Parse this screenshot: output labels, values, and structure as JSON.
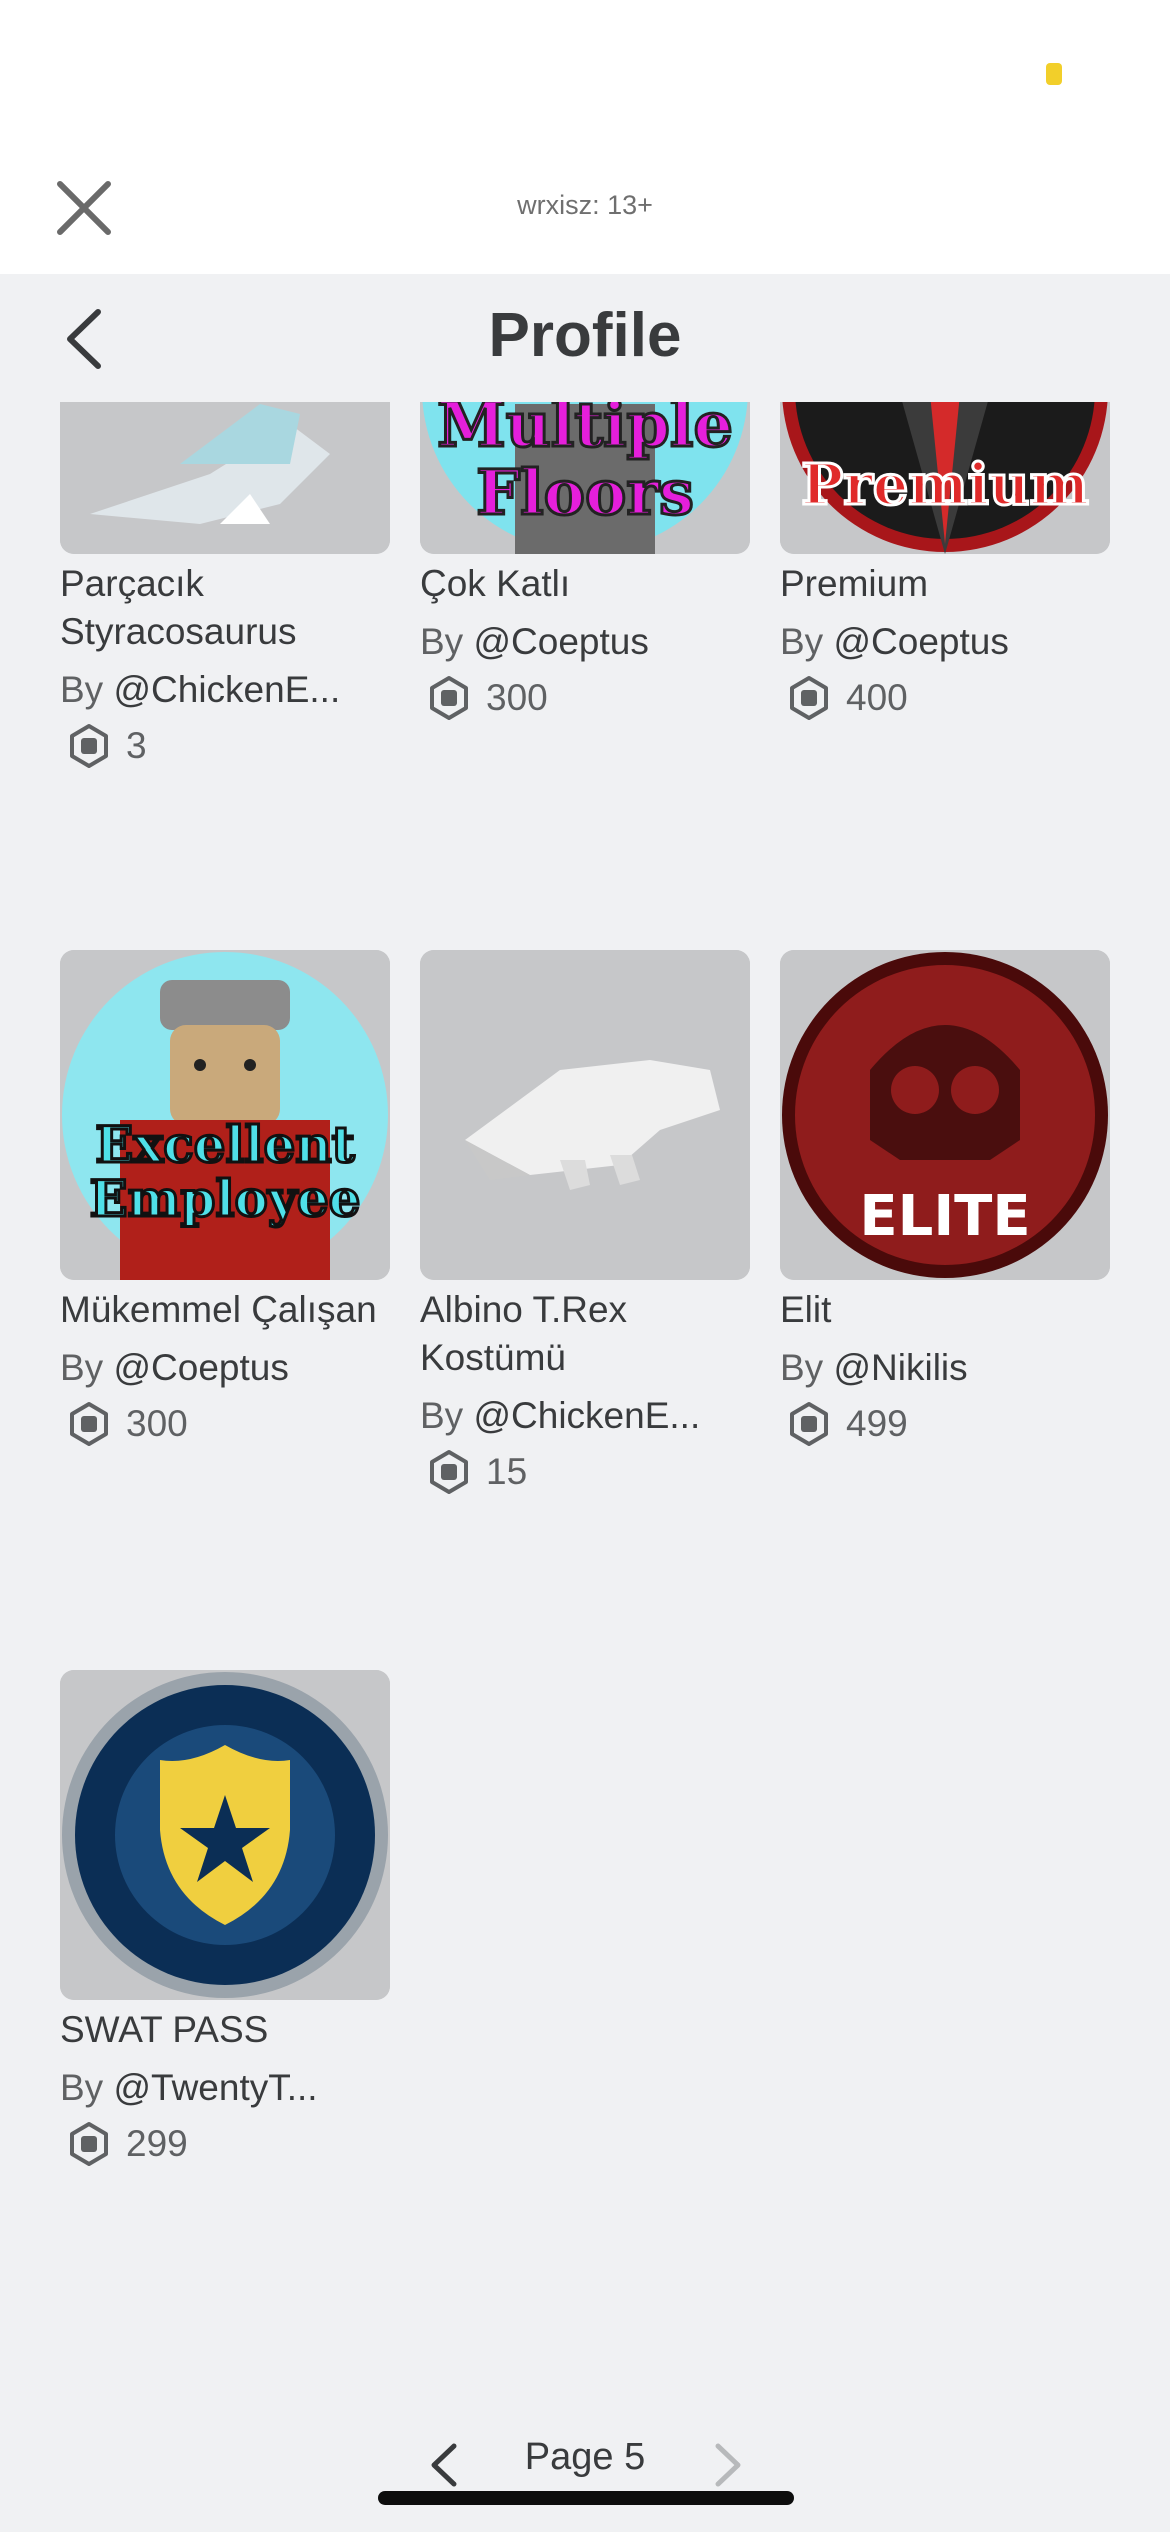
{
  "header": {
    "user_label": "wrxisz: 13+",
    "title": "Profile"
  },
  "items": [
    {
      "name": "Parçacık Styracosaurus",
      "by": "By",
      "creator": "@ChickenE...",
      "price": "3",
      "thumb": "dino-icon"
    },
    {
      "name": "Çok Katlı",
      "by": "By",
      "creator": "@Coeptus",
      "price": "300",
      "thumb": "multiple-floors-badge",
      "thumb_text_1": "Multiple",
      "thumb_text_2": "Floors"
    },
    {
      "name": "Premium",
      "by": "By",
      "creator": "@Coeptus",
      "price": "400",
      "thumb": "premium-badge",
      "thumb_text_1": "Premium"
    },
    {
      "name": "Mükemmel Çalışan",
      "by": "By",
      "creator": "@Coeptus",
      "price": "300",
      "thumb": "excellent-employee-badge",
      "thumb_text_1": "Excellent",
      "thumb_text_2": "Employee"
    },
    {
      "name": "Albino T.Rex Kostümü",
      "by": "By",
      "creator": "@ChickenE...",
      "price": "15",
      "thumb": "trex-icon"
    },
    {
      "name": "Elit",
      "by": "By",
      "creator": "@Nikilis",
      "price": "499",
      "thumb": "elite-skull-badge",
      "thumb_text_1": "ELITE"
    },
    {
      "name": "SWAT PASS",
      "by": "By",
      "creator": "@TwentyT...",
      "price": "299",
      "thumb": "swat-shield-badge"
    }
  ],
  "pager": {
    "label": "Page 5"
  },
  "colors": {
    "background": "#f0f1f3",
    "text": "#393b3d",
    "thumb_bg": "#c8c9cb"
  }
}
